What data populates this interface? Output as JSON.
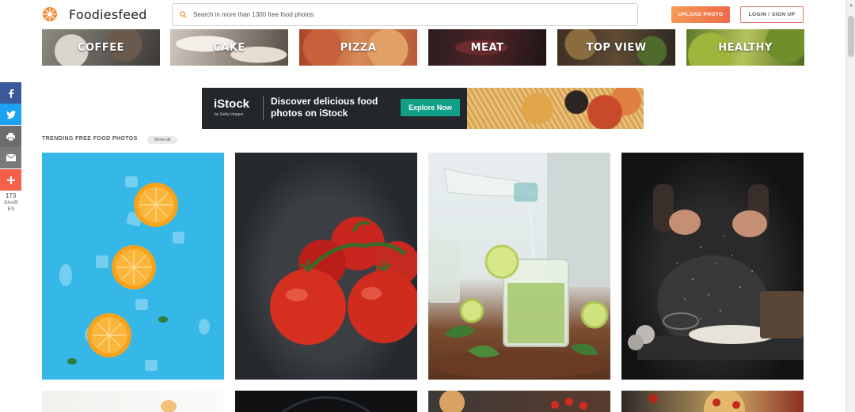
{
  "header": {
    "brand": "Foodiesfeed",
    "search_placeholder": "Search in more than 1300 free food photos",
    "upload_label": "UPLOAD PHOTO",
    "login_label": "LOGIN / SIGN UP"
  },
  "categories": [
    {
      "label": "COFFEE"
    },
    {
      "label": "CAKE"
    },
    {
      "label": "PIZZA"
    },
    {
      "label": "MEAT"
    },
    {
      "label": "TOP VIEW"
    },
    {
      "label": "HEALTHY"
    }
  ],
  "banner": {
    "logo": "iStock",
    "logo_sub": "by Getty Images",
    "text": "Discover delicious food photos on iStock",
    "button": "Explore Now"
  },
  "social": {
    "share_count": "173",
    "share_label": "SHARES",
    "icons": [
      "facebook-icon",
      "twitter-icon",
      "print-icon",
      "email-icon",
      "plus-icon"
    ]
  },
  "trending": {
    "title": "TRENDING FREE FOOD PHOTOS",
    "show_all": "Show all"
  },
  "colors": {
    "accent": "#ee6a4c",
    "istock_button": "#0f9e86",
    "facebook": "#3b5998",
    "twitter": "#1da1f2",
    "more": "#f4604b"
  }
}
